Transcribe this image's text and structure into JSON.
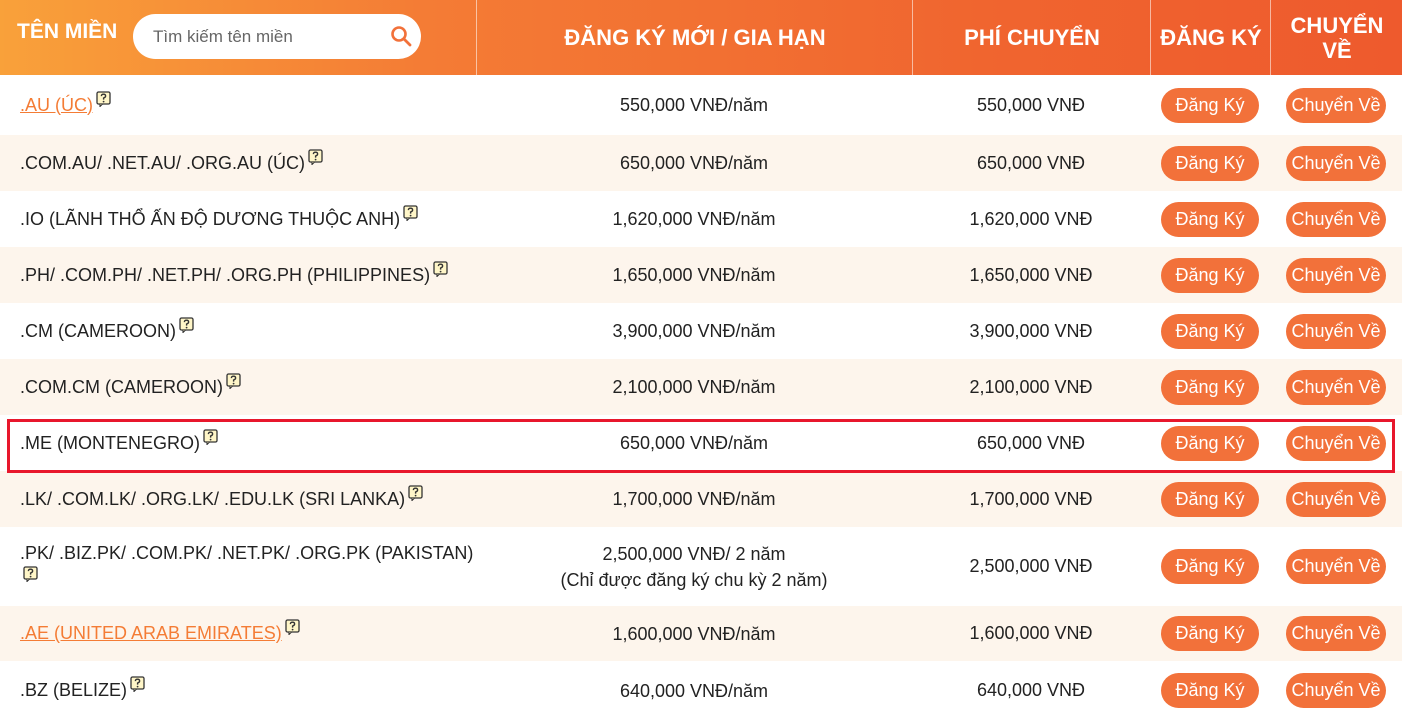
{
  "header": {
    "domain_label": "TÊN MIỀN",
    "search_placeholder": "Tìm kiếm tên miền",
    "col_price": "ĐĂNG KÝ MỚI / GIA HẠN",
    "col_fee": "PHÍ CHUYỂN",
    "col_register": "ĐĂNG KÝ",
    "col_transfer_line1": "CHUYỂN",
    "col_transfer_line2": "VỀ"
  },
  "buttons": {
    "register": "Đăng Ký",
    "transfer": "Chuyển Về"
  },
  "colors": {
    "header_start": "#f9a13a",
    "header_end": "#ee5a2d",
    "button": "#f2713a",
    "alt_row": "#fdf5ec",
    "highlight": "#e8172c",
    "link": "#f47c35"
  },
  "icons": {
    "search": "search-icon",
    "help": "question-icon"
  },
  "rows": [
    {
      "name": ".AU (ÚC)",
      "link": true,
      "price": "550,000 VNĐ/năm",
      "fee": "550,000 VNĐ"
    },
    {
      "name": ".COM.AU/ .NET.AU/ .ORG.AU (ÚC)",
      "price": "650,000 VNĐ/năm",
      "fee": "650,000 VNĐ"
    },
    {
      "name": ".IO (LÃNH THỔ ẤN ĐỘ DƯƠNG THUỘC ANH)",
      "price": "1,620,000 VNĐ/năm",
      "fee": "1,620,000 VNĐ"
    },
    {
      "name": ".PH/ .COM.PH/ .NET.PH/ .ORG.PH (PHILIPPINES)",
      "price": "1,650,000 VNĐ/năm",
      "fee": "1,650,000 VNĐ"
    },
    {
      "name": ".CM (CAMEROON)",
      "price": "3,900,000 VNĐ/năm",
      "fee": "3,900,000 VNĐ"
    },
    {
      "name": ".COM.CM (CAMEROON)",
      "price": "2,100,000 VNĐ/năm",
      "fee": "2,100,000 VNĐ"
    },
    {
      "name": ".ME (MONTENEGRO)",
      "price": "650,000 VNĐ/năm",
      "fee": "650,000 VNĐ",
      "highlighted": true
    },
    {
      "name": ".LK/ .COM.LK/ .ORG.LK/ .EDU.LK (SRI LANKA)",
      "price": "1,700,000 VNĐ/năm",
      "fee": "1,700,000 VNĐ"
    },
    {
      "name": ".PK/ .BIZ.PK/ .COM.PK/ .NET.PK/ .ORG.PK (PAKISTAN)",
      "price": "2,500,000 VNĐ/ 2 năm",
      "price_note": "(Chỉ được đăng ký chu kỳ 2 năm)",
      "fee": "2,500,000 VNĐ"
    },
    {
      "name": ".AE (UNITED ARAB EMIRATES)",
      "link": true,
      "price": "1,600,000 VNĐ/năm",
      "fee": "1,600,000 VNĐ"
    },
    {
      "name": ".BZ (BELIZE)",
      "price": "640,000 VNĐ/năm",
      "fee": "640,000 VNĐ"
    }
  ]
}
